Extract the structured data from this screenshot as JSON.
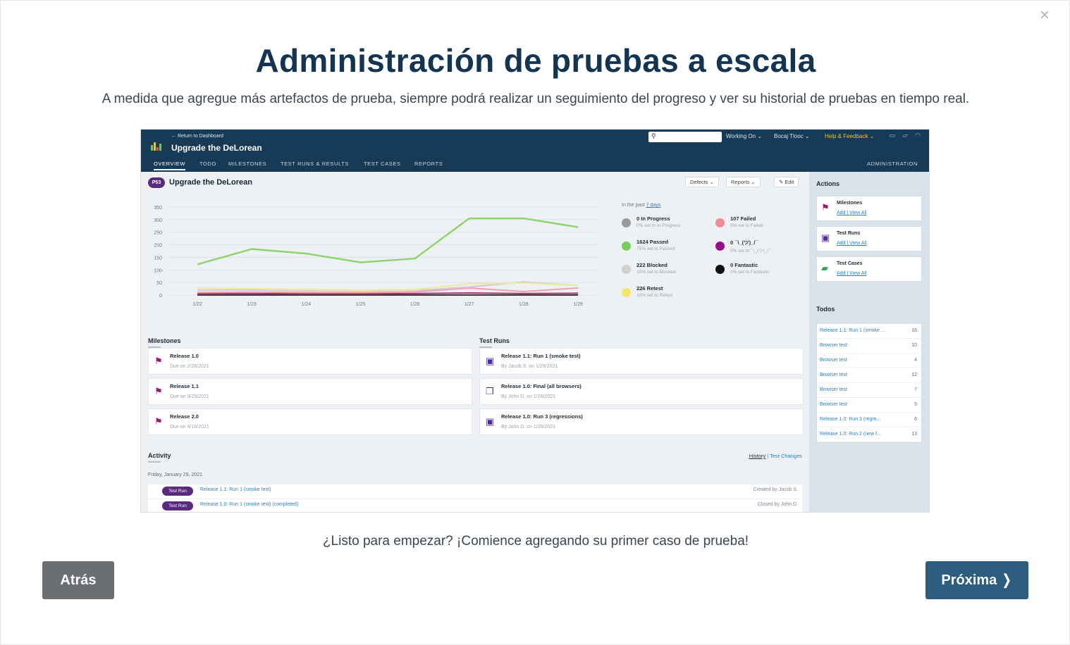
{
  "modal": {
    "close_glyph": "×",
    "title": "Administración de pruebas a escala",
    "subtitle": "A medida que agregue más artefactos de prueba, siempre podrá realizar un seguimiento del progreso y ver su historial de pruebas en tiempo real.",
    "ready_text": "¿Listo para empezar? ¡Comience agregando su primer caso de prueba!",
    "back_label": "Atrás",
    "next_label": "Próxima ❭",
    "colors": {
      "title": "#133552",
      "next": "#2c5d7f",
      "back": "#6b6e72"
    }
  },
  "app": {
    "header": {
      "return_link": "← Return to Dashboard",
      "project_name": "Upgrade the DeLorean",
      "search_icon": "search-icon",
      "menus": [
        "Working On ⌄",
        "Bocaj Tlooc ⌄",
        "Help & Feedback ⌄"
      ],
      "tabs": [
        "OVERVIEW",
        "TODO",
        "MILESTONES",
        "TEST RUNS & RESULTS",
        "TEST CASES",
        "REPORTS"
      ],
      "admin_tab": "ADMINISTRATION"
    },
    "overview": {
      "badge": "P53",
      "title": "Upgrade the DeLorean",
      "buttons": [
        "Defects ⌄",
        "Reports ⌄",
        "✎ Edit"
      ]
    },
    "chart_data": {
      "type": "line",
      "x": [
        "1/22",
        "1/23",
        "1/24",
        "1/25",
        "1/26",
        "1/27",
        "1/28",
        "1/29"
      ],
      "ylim": [
        0,
        350
      ],
      "yticks": [
        "350",
        "300",
        "250",
        "200",
        "150",
        "100",
        "50",
        "0"
      ],
      "grid": true,
      "series": [
        {
          "color": "#8fd46d",
          "values": [
            122,
            183,
            165,
            130,
            145,
            305,
            305,
            270
          ]
        },
        {
          "color": "#eceaa0",
          "values": [
            28,
            25,
            22,
            20,
            22,
            45,
            48,
            38
          ]
        },
        {
          "color": "#d8c6d8",
          "values": [
            20,
            20,
            18,
            18,
            18,
            32,
            52,
            38
          ]
        },
        {
          "color": "#f0a0a8",
          "values": [
            10,
            12,
            10,
            10,
            12,
            28,
            14,
            28
          ]
        },
        {
          "color": "#a0306f",
          "values": [
            6,
            6,
            5,
            5,
            6,
            8,
            6,
            7
          ]
        },
        {
          "color": "#3a3a3a",
          "values": [
            0,
            0,
            0,
            0,
            0,
            0,
            0,
            0
          ]
        }
      ]
    },
    "stats": {
      "past_label": "In the past",
      "past_link": "7 days",
      "items": [
        {
          "label": "0 In Progress",
          "sub": "0% set to In Progress",
          "color": "#9b9b9b"
        },
        {
          "label": "107 Failed",
          "sub": "5% set to Failed",
          "color": "#f08a93"
        },
        {
          "label": "1624 Passed",
          "sub": "75% set to Passed",
          "color": "#77cc5e"
        },
        {
          "label": "0 ¯\\_(ツ)_/¯",
          "sub": "0% set to ¯\\_(ツ)_/¯",
          "color": "#9a0a8c"
        },
        {
          "label": "222 Blocked",
          "sub": "10% set to Blocked",
          "color": "#d0d0d0"
        },
        {
          "label": "0 Fantastic",
          "sub": "0% set to Fantastic",
          "color": "#101010"
        },
        {
          "label": "226 Retest",
          "sub": "10% set to Retest",
          "color": "#f3e66a"
        }
      ]
    },
    "milestones": {
      "heading": "Milestones",
      "items": [
        {
          "title": "Release 1.0",
          "sub": "Due on 2/28/2021"
        },
        {
          "title": "Release 1.1",
          "sub": "Due on 3/25/2021"
        },
        {
          "title": "Release 2.0",
          "sub": "Due on 4/18/2021"
        }
      ]
    },
    "test_runs": {
      "heading": "Test Runs",
      "items": [
        {
          "title": "Release 1.1: Run 1 (smoke test)",
          "sub": "By Jacob S. on 1/29/2021"
        },
        {
          "title": "Release 1.0: Final (all browsers)",
          "sub": "By John D. on 1/26/2021"
        },
        {
          "title": "Release 1.0: Run 3 (regressions)",
          "sub": "By John D. on 1/25/2021"
        }
      ]
    },
    "activity": {
      "heading": "Activity",
      "history": "History",
      "sep": " | ",
      "test_changes": "Test Changes",
      "date": "Friday, January 29, 2021",
      "rows": [
        {
          "pill": "Test Run",
          "link": "Release 1.1: Run 1 (smoke test)",
          "by": "Created by Jacob S."
        },
        {
          "pill": "Test Run",
          "link": "Release 1.0: Run 1 (smoke test) (completed)",
          "by": "Closed by John D."
        }
      ]
    },
    "sidebar": {
      "actions_heading": "Actions",
      "actions": [
        {
          "title": "Milestones",
          "links": "Add | View All",
          "icon": "flag-icon",
          "color": "#9d1a74"
        },
        {
          "title": "Test Runs",
          "links": "Add | View All",
          "icon": "clipboard-icon",
          "color": "#5a2a9d"
        },
        {
          "title": "Test Cases",
          "links": "Add | View All",
          "icon": "folder-icon",
          "color": "#2fa84f"
        }
      ],
      "todos_heading": "Todos",
      "todos": [
        {
          "name": "Release 1.1: Run 1 (smoke ...",
          "count": "16"
        },
        {
          "name": "Browser test",
          "count": "10"
        },
        {
          "name": "Browser test",
          "count": "4"
        },
        {
          "name": "Browser test",
          "count": "12"
        },
        {
          "name": "Browser test",
          "count": "7"
        },
        {
          "name": "Browser test",
          "count": "5"
        },
        {
          "name": "Release 1.0: Run 3 (regre...",
          "count": "6"
        },
        {
          "name": "Release 1.0: Run 2 (new f...",
          "count": "13"
        }
      ]
    }
  }
}
